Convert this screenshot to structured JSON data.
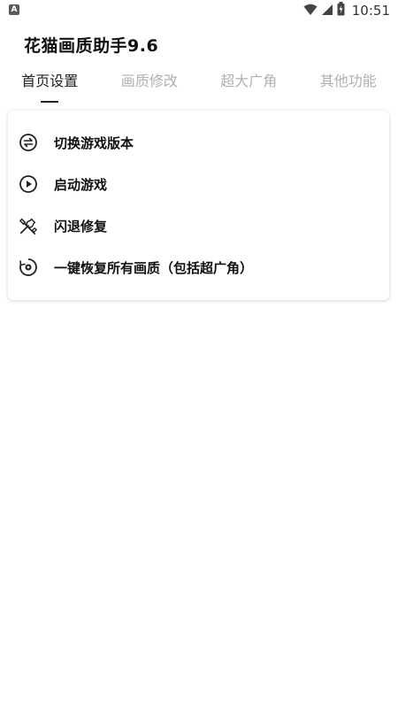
{
  "status_bar": {
    "left_badge": "A",
    "time": "10:51",
    "icons": [
      "wifi-icon",
      "signal-icon",
      "battery-icon"
    ]
  },
  "app": {
    "title": "花猫画质助手9.6"
  },
  "tabs": [
    {
      "label": "首页设置",
      "active": true
    },
    {
      "label": "画质修改",
      "active": false
    },
    {
      "label": "超大广角",
      "active": false
    },
    {
      "label": "其他功能",
      "active": false
    }
  ],
  "menu": {
    "items": [
      {
        "label": "切换游戏版本",
        "icon": "swap-icon"
      },
      {
        "label": "启动游戏",
        "icon": "play-icon"
      },
      {
        "label": "闪退修复",
        "icon": "tools-icon"
      },
      {
        "label": "一键恢复所有画质（包括超广角）",
        "icon": "restore-icon"
      }
    ]
  },
  "colors": {
    "active_tab": "#222222",
    "inactive_tab": "#b0b0b0",
    "background": "#ffffff"
  }
}
